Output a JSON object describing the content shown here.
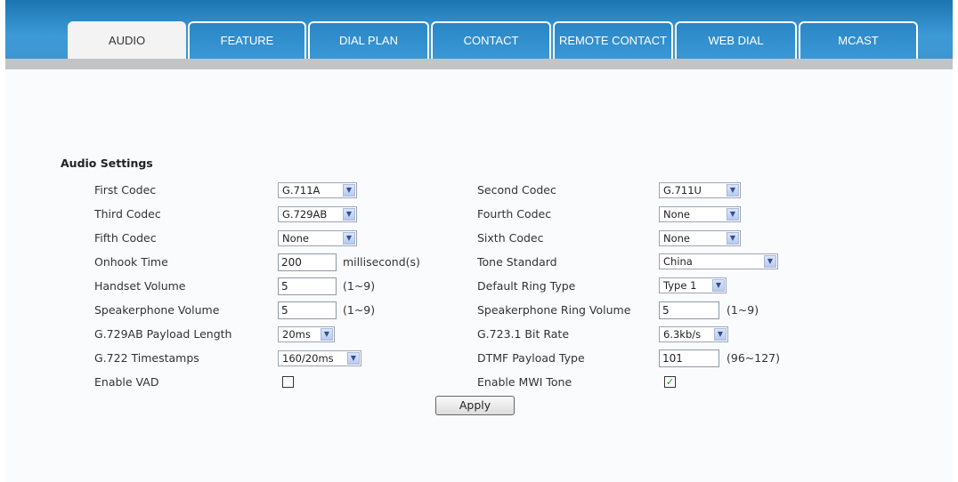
{
  "tabs": [
    {
      "label": "AUDIO",
      "active": true
    },
    {
      "label": "FEATURE",
      "active": false
    },
    {
      "label": "DIAL PLAN",
      "active": false
    },
    {
      "label": "CONTACT",
      "active": false
    },
    {
      "label": "REMOTE CONTACT",
      "active": false
    },
    {
      "label": "WEB DIAL",
      "active": false
    },
    {
      "label": "MCAST",
      "active": false
    }
  ],
  "section_title": "Audio Settings",
  "left": {
    "first_codec": {
      "label": "First Codec",
      "value": "G.711A"
    },
    "third_codec": {
      "label": "Third Codec",
      "value": "G.729AB"
    },
    "fifth_codec": {
      "label": "Fifth Codec",
      "value": "None"
    },
    "onhook_time": {
      "label": "Onhook Time",
      "value": "200",
      "unit": "millisecond(s)"
    },
    "handset_volume": {
      "label": "Handset Volume",
      "value": "5",
      "unit": "(1~9)"
    },
    "speakerphone_volume": {
      "label": "Speakerphone Volume",
      "value": "5",
      "unit": "(1~9)"
    },
    "g729ab_payload": {
      "label": "G.729AB Payload Length",
      "value": "20ms"
    },
    "g722_timestamps": {
      "label": "G.722 Timestamps",
      "value": "160/20ms"
    },
    "enable_vad": {
      "label": "Enable VAD",
      "checked": false
    }
  },
  "right": {
    "second_codec": {
      "label": "Second Codec",
      "value": "G.711U"
    },
    "fourth_codec": {
      "label": "Fourth Codec",
      "value": "None"
    },
    "sixth_codec": {
      "label": "Sixth Codec",
      "value": "None"
    },
    "tone_standard": {
      "label": "Tone Standard",
      "value": "China"
    },
    "default_ring_type": {
      "label": "Default Ring Type",
      "value": "Type 1"
    },
    "speakerphone_ring_volume": {
      "label": "Speakerphone Ring Volume",
      "value": "5",
      "unit": "(1~9)"
    },
    "g7231_bit_rate": {
      "label": "G.723.1 Bit Rate",
      "value": "6.3kb/s"
    },
    "dtmf_payload_type": {
      "label": "DTMF Payload Type",
      "value": "101",
      "unit": "(96~127)"
    },
    "enable_mwi_tone": {
      "label": "Enable MWI Tone",
      "checked": true
    }
  },
  "apply_label": "Apply",
  "colors": {
    "tab_bar": "#2a86c4",
    "active_tab": "#f3f3f3",
    "sub_bar": "#c3c4c6",
    "checkmark": "#2a8a2a"
  }
}
